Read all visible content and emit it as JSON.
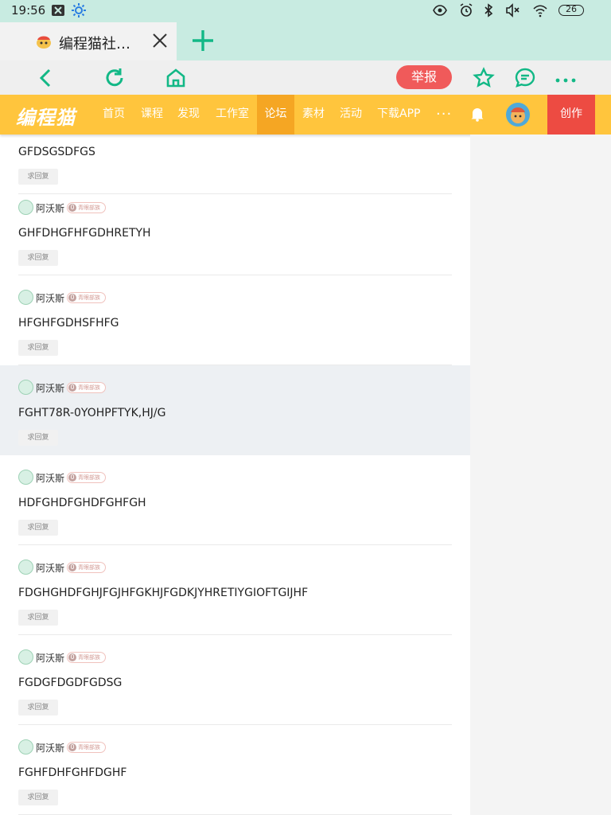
{
  "status": {
    "time": "19:56",
    "battery": "26"
  },
  "tab": {
    "title": "编程猫社…"
  },
  "nav": {
    "report": "举报"
  },
  "site": {
    "logo": "编程猫",
    "menu": [
      "首页",
      "课程",
      "发现",
      "工作室",
      "论坛",
      "素材",
      "活动",
      "下载APP"
    ],
    "more": "···",
    "create": "创作"
  },
  "feed": {
    "top_post": {
      "title": "GFDSGSDFGS",
      "tag": "求回复"
    },
    "posts": [
      {
        "author": "阿沃斯",
        "level": "0",
        "badge": "青眼部族",
        "title": "GHFDHGFHFGDHRETYH",
        "tag": "求回复"
      },
      {
        "author": "阿沃斯",
        "level": "0",
        "badge": "青眼部族",
        "title": "HFGHFGDHSFHFG",
        "tag": "求回复"
      },
      {
        "author": "阿沃斯",
        "level": "0",
        "badge": "青眼部族",
        "title": "FGHT78R-0YOHPFTYK,HJ/G",
        "tag": "求回复"
      },
      {
        "author": "阿沃斯",
        "level": "0",
        "badge": "青眼部族",
        "title": "HDFGHDFGHDFGHFGH",
        "tag": "求回复"
      },
      {
        "author": "阿沃斯",
        "level": "0",
        "badge": "青眼部族",
        "title": "FDGHGHDFGHJFGJHFGKHJFGDKJYHRETIYGIOFTGIJHF",
        "tag": "求回复"
      },
      {
        "author": "阿沃斯",
        "level": "0",
        "badge": "青眼部族",
        "title": "FGDGFDGDFGDSG",
        "tag": "求回复"
      },
      {
        "author": "阿沃斯",
        "level": "0",
        "badge": "青眼部族",
        "title": "FGHFDHFGHFDGHF",
        "tag": "求回复"
      }
    ]
  }
}
